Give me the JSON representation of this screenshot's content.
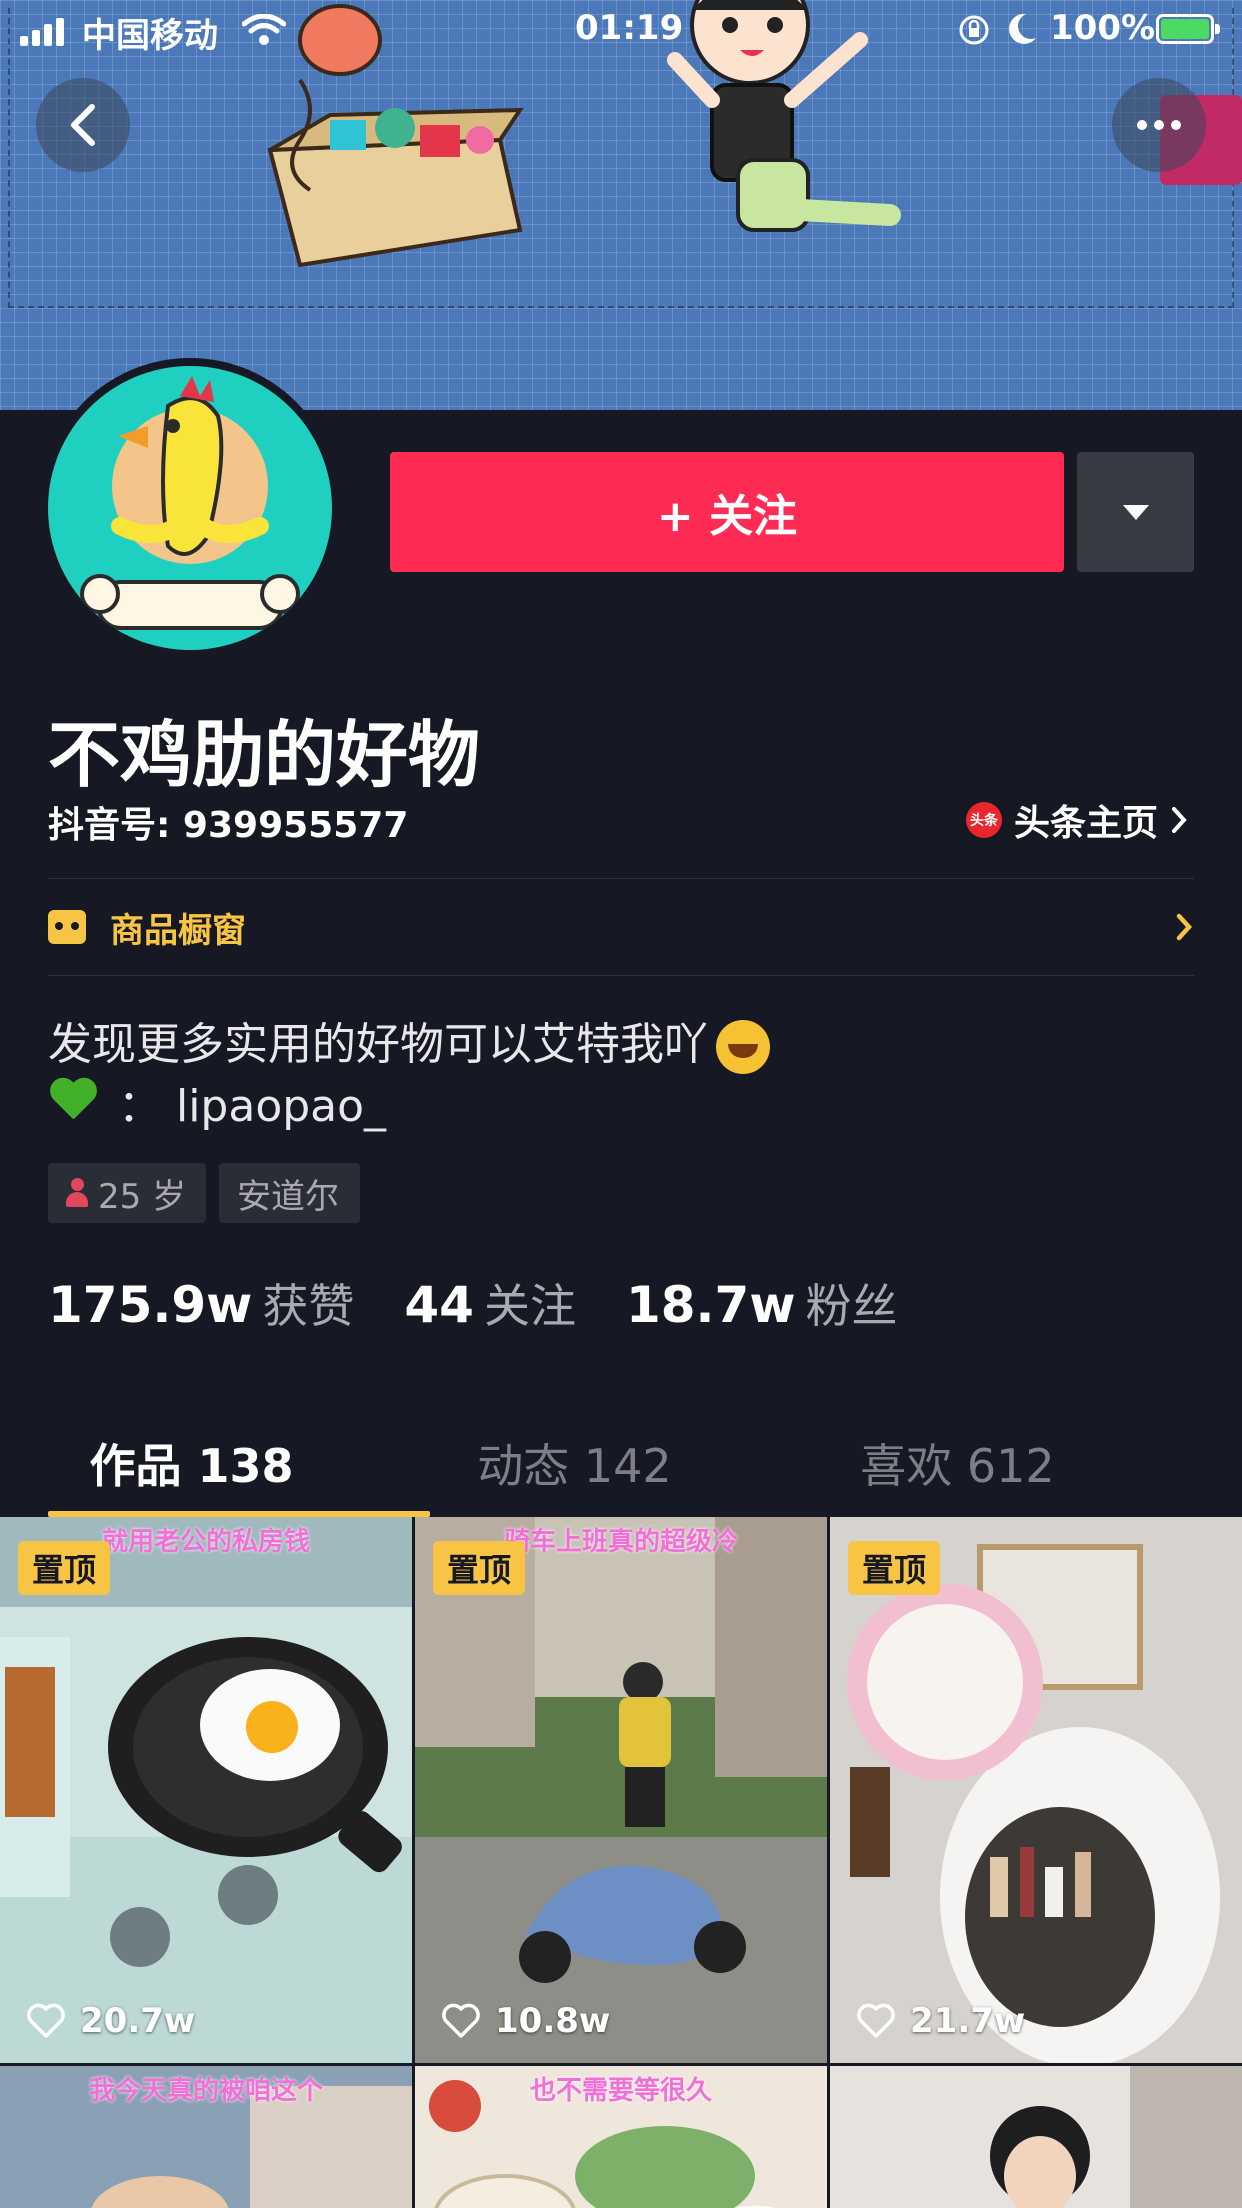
{
  "status_bar": {
    "carrier": "中国移动",
    "time": "01:19",
    "battery": "100%"
  },
  "profile": {
    "follow_label": "+ 关注",
    "name": "不鸡肋的好物",
    "douyin_id": "抖音号: 939955577",
    "toutiao_logo": "头条",
    "toutiao_label": "头条主页",
    "shop_label": "商品橱窗",
    "bio_line1": "发现更多实用的好物可以艾特我吖",
    "bio_line2": "：  lipaopao_",
    "tags": {
      "age": "25 岁",
      "location": "安道尔"
    },
    "stats": [
      {
        "value": "175.9w",
        "label": "获赞"
      },
      {
        "value": "44",
        "label": "关注"
      },
      {
        "value": "18.7w",
        "label": "粉丝"
      }
    ]
  },
  "tabs": [
    {
      "label": "作品 138",
      "active": true
    },
    {
      "label": "动态 142",
      "active": false
    },
    {
      "label": "喜欢 612",
      "active": false
    }
  ],
  "videos": [
    {
      "badge": "置顶",
      "caption": "就用老公的私房钱",
      "likes": "20.7w"
    },
    {
      "badge": "置顶",
      "caption": "骑车上班真的超级冷",
      "likes": "10.8w"
    },
    {
      "badge": "置顶",
      "caption": "",
      "likes": "21.7w"
    },
    {
      "caption": "我今天真的被咱这个"
    },
    {
      "caption": "也不需要等很久"
    },
    {
      "caption": ""
    }
  ],
  "colors": {
    "background": "#161823",
    "follow_red": "#fe2c55",
    "accent_yellow": "#f7c444"
  }
}
